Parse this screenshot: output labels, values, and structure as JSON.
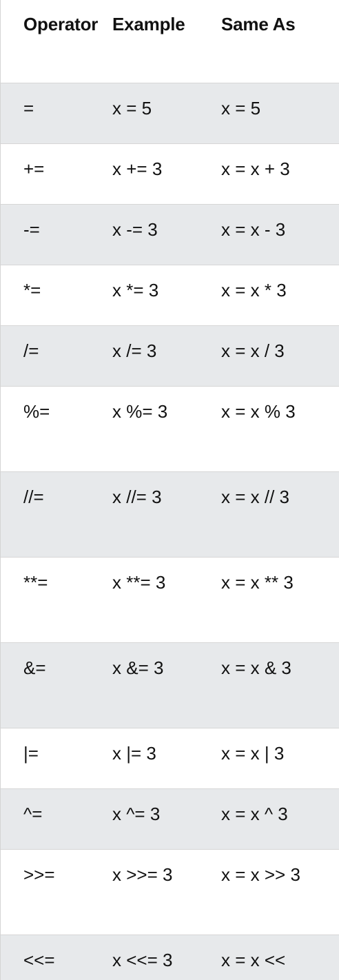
{
  "table": {
    "headers": {
      "operator": "Operator",
      "example": "Example",
      "same_as": "Same As"
    },
    "rows": [
      {
        "operator": "=",
        "example": "x = 5",
        "same_as": "x = 5"
      },
      {
        "operator": "+=",
        "example": "x += 3",
        "same_as": "x = x + 3"
      },
      {
        "operator": "-=",
        "example": "x -= 3",
        "same_as": "x = x - 3"
      },
      {
        "operator": "*=",
        "example": "x *= 3",
        "same_as": "x = x * 3"
      },
      {
        "operator": "/=",
        "example": "x /= 3",
        "same_as": "x = x / 3"
      },
      {
        "operator": "%=",
        "example": "x %= 3",
        "same_as": "x = x % 3"
      },
      {
        "operator": "//=",
        "example": "x //= 3",
        "same_as": "x = x // 3"
      },
      {
        "operator": "**=",
        "example": "x **= 3",
        "same_as": "x = x ** 3"
      },
      {
        "operator": "&=",
        "example": "x &= 3",
        "same_as": "x = x & 3"
      },
      {
        "operator": "|=",
        "example": "x |= 3",
        "same_as": "x = x | 3"
      },
      {
        "operator": "^=",
        "example": "x ^= 3",
        "same_as": "x = x ^ 3"
      },
      {
        "operator": ">>=",
        "example": "x >>= 3",
        "same_as": "x = x >> 3"
      },
      {
        "operator": "<<=",
        "example": "x <<= 3",
        "same_as": "x = x <<"
      }
    ]
  },
  "colors": {
    "stripe": "#e7e9eb",
    "border": "#d6d6d6",
    "text": "#111111"
  }
}
